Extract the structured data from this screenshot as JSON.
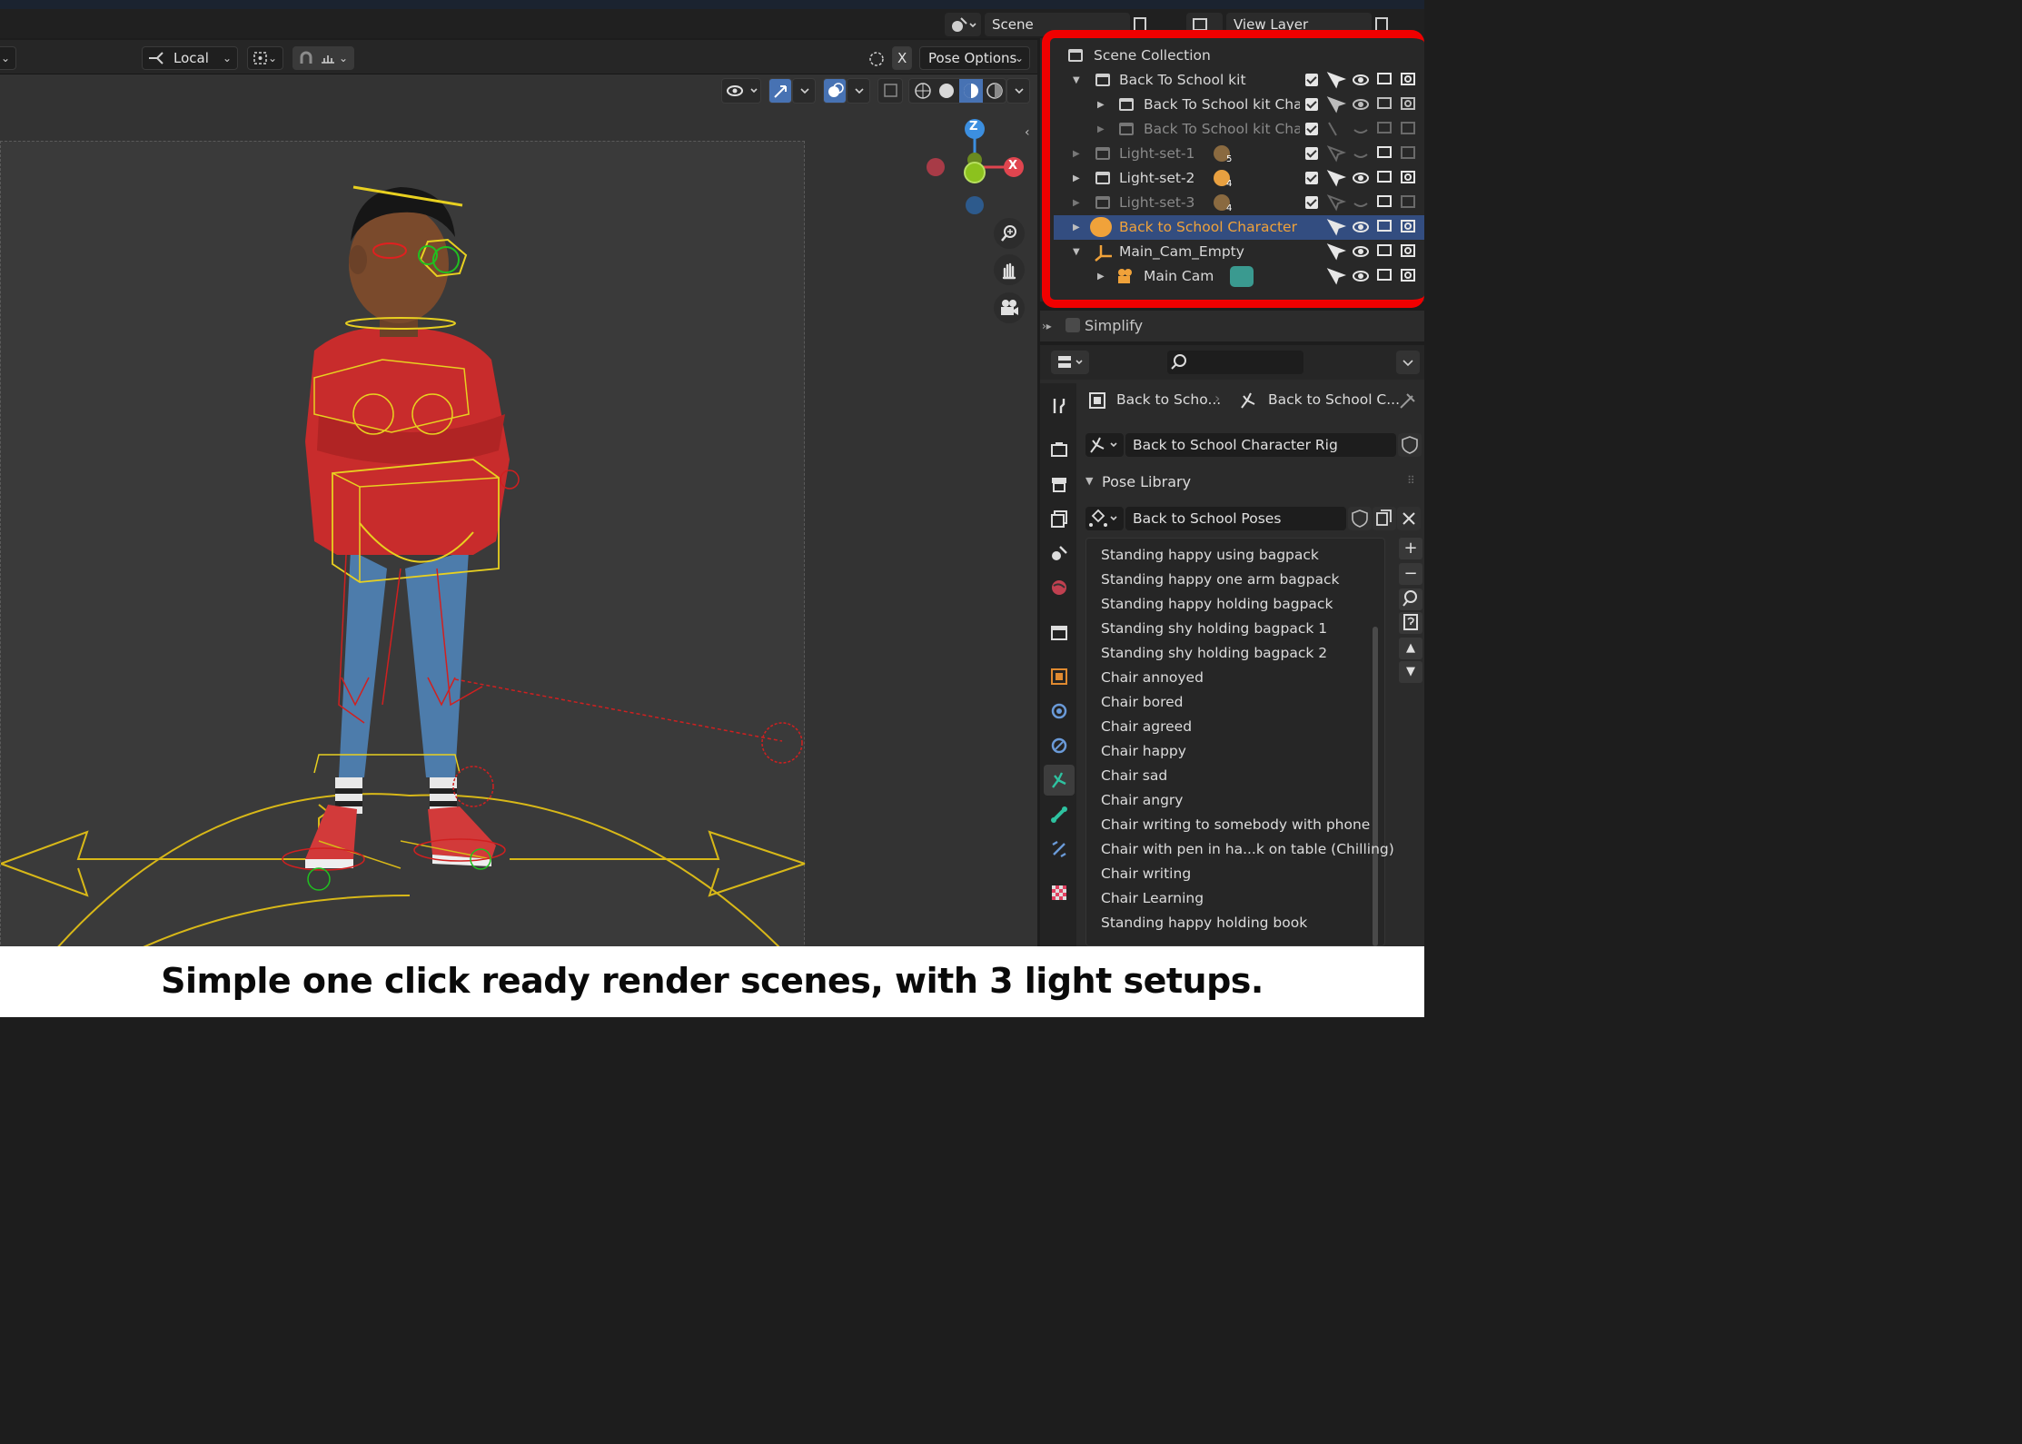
{
  "scene_bar": {
    "scene_label": "Scene",
    "view_layer_label": "View Layer"
  },
  "viewport_header": {
    "transform_orientation": "Local",
    "pose_options": "Pose Options",
    "close_x": "X"
  },
  "gizmo": {
    "z": "Z",
    "x": "X"
  },
  "outliner": {
    "root": "Scene Collection",
    "rows": [
      {
        "label": "Back To School kit",
        "badge": ""
      },
      {
        "label": "Back To School kit Char M",
        "badge": ""
      },
      {
        "label": "Back To School kit Char F",
        "badge": ""
      },
      {
        "label": "Light-set-1",
        "badge": "5"
      },
      {
        "label": "Light-set-2",
        "badge": "4"
      },
      {
        "label": "Light-set-3",
        "badge": "4"
      },
      {
        "label": "Back to School Character",
        "badge": ""
      },
      {
        "label": "Main_Cam_Empty",
        "badge": ""
      },
      {
        "label": "Main Cam",
        "badge": ""
      }
    ]
  },
  "simplify": {
    "label": "Simplify"
  },
  "properties": {
    "breadcrumb_object": "Back to Scho...",
    "breadcrumb_data": "Back to School C...",
    "armature_name": "Back to School Character Rig",
    "panel_title": "Pose Library",
    "pose_library_name": "Back to School Poses",
    "poses": [
      "Standing happy using bagpack",
      "Standing happy one arm bagpack",
      "Standing happy holding bagpack",
      "Standing shy holding bagpack 1",
      "Standing shy holding bagpack 2",
      "Chair annoyed",
      "Chair bored",
      "Chair agreed",
      "Chair happy",
      "Chair sad",
      "Chair angry",
      "Chair writing to somebody with phone",
      "Chair with pen in ha...k on table (Chilling)",
      "Chair writing",
      "Chair Learning",
      "Standing happy holding book"
    ]
  },
  "caption": "Simple one click ready render scenes, with 3 light setups.",
  "colors": {
    "selection_blue": "#334d80",
    "active_orange": "#f0a23a",
    "highlight_red": "#f00000",
    "axis_x": "#e0454f",
    "axis_y": "#8cc21e",
    "axis_z": "#3c8fe0"
  }
}
